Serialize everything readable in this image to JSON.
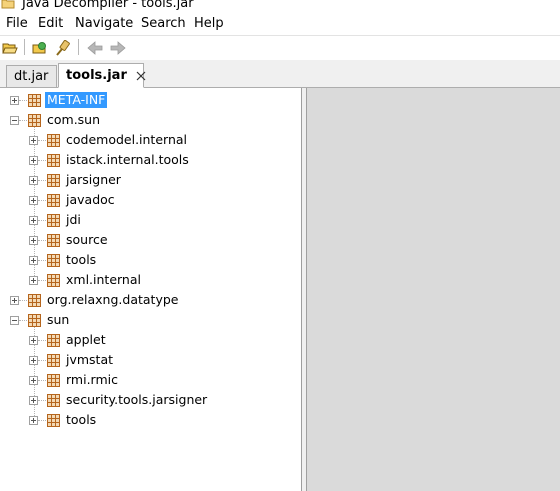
{
  "window": {
    "title": "Java Decompiler - tools.jar"
  },
  "menu": [
    "File",
    "Edit",
    "Navigate",
    "Search",
    "Help"
  ],
  "toolbar": {
    "buttons": [
      "open-file-icon",
      "open-type-icon",
      "search-icon",
      "back-arrow-icon",
      "forward-arrow-icon"
    ]
  },
  "tabs": [
    {
      "label": "dt.jar",
      "active": false
    },
    {
      "label": "tools.jar",
      "active": true
    }
  ],
  "tree": [
    {
      "label": "META-INF",
      "level": 0,
      "expanded": false,
      "selected": true
    },
    {
      "label": "com.sun",
      "level": 0,
      "expanded": true,
      "selected": false
    },
    {
      "label": "codemodel.internal",
      "level": 1,
      "expanded": false,
      "selected": false
    },
    {
      "label": "istack.internal.tools",
      "level": 1,
      "expanded": false,
      "selected": false
    },
    {
      "label": "jarsigner",
      "level": 1,
      "expanded": false,
      "selected": false
    },
    {
      "label": "javadoc",
      "level": 1,
      "expanded": false,
      "selected": false
    },
    {
      "label": "jdi",
      "level": 1,
      "expanded": false,
      "selected": false
    },
    {
      "label": "source",
      "level": 1,
      "expanded": false,
      "selected": false
    },
    {
      "label": "tools",
      "level": 1,
      "expanded": false,
      "selected": false
    },
    {
      "label": "xml.internal",
      "level": 1,
      "expanded": false,
      "selected": false
    },
    {
      "label": "org.relaxng.datatype",
      "level": 0,
      "expanded": false,
      "selected": false
    },
    {
      "label": "sun",
      "level": 0,
      "expanded": true,
      "selected": false
    },
    {
      "label": "applet",
      "level": 1,
      "expanded": false,
      "selected": false
    },
    {
      "label": "jvmstat",
      "level": 1,
      "expanded": false,
      "selected": false
    },
    {
      "label": "rmi.rmic",
      "level": 1,
      "expanded": false,
      "selected": false
    },
    {
      "label": "security.tools.jarsigner",
      "level": 1,
      "expanded": false,
      "selected": false
    },
    {
      "label": "tools",
      "level": 1,
      "expanded": false,
      "selected": false
    }
  ],
  "colors": {
    "selection": "#3399ff",
    "package_icon": "#b5651d",
    "content_bg": "#dadada"
  }
}
